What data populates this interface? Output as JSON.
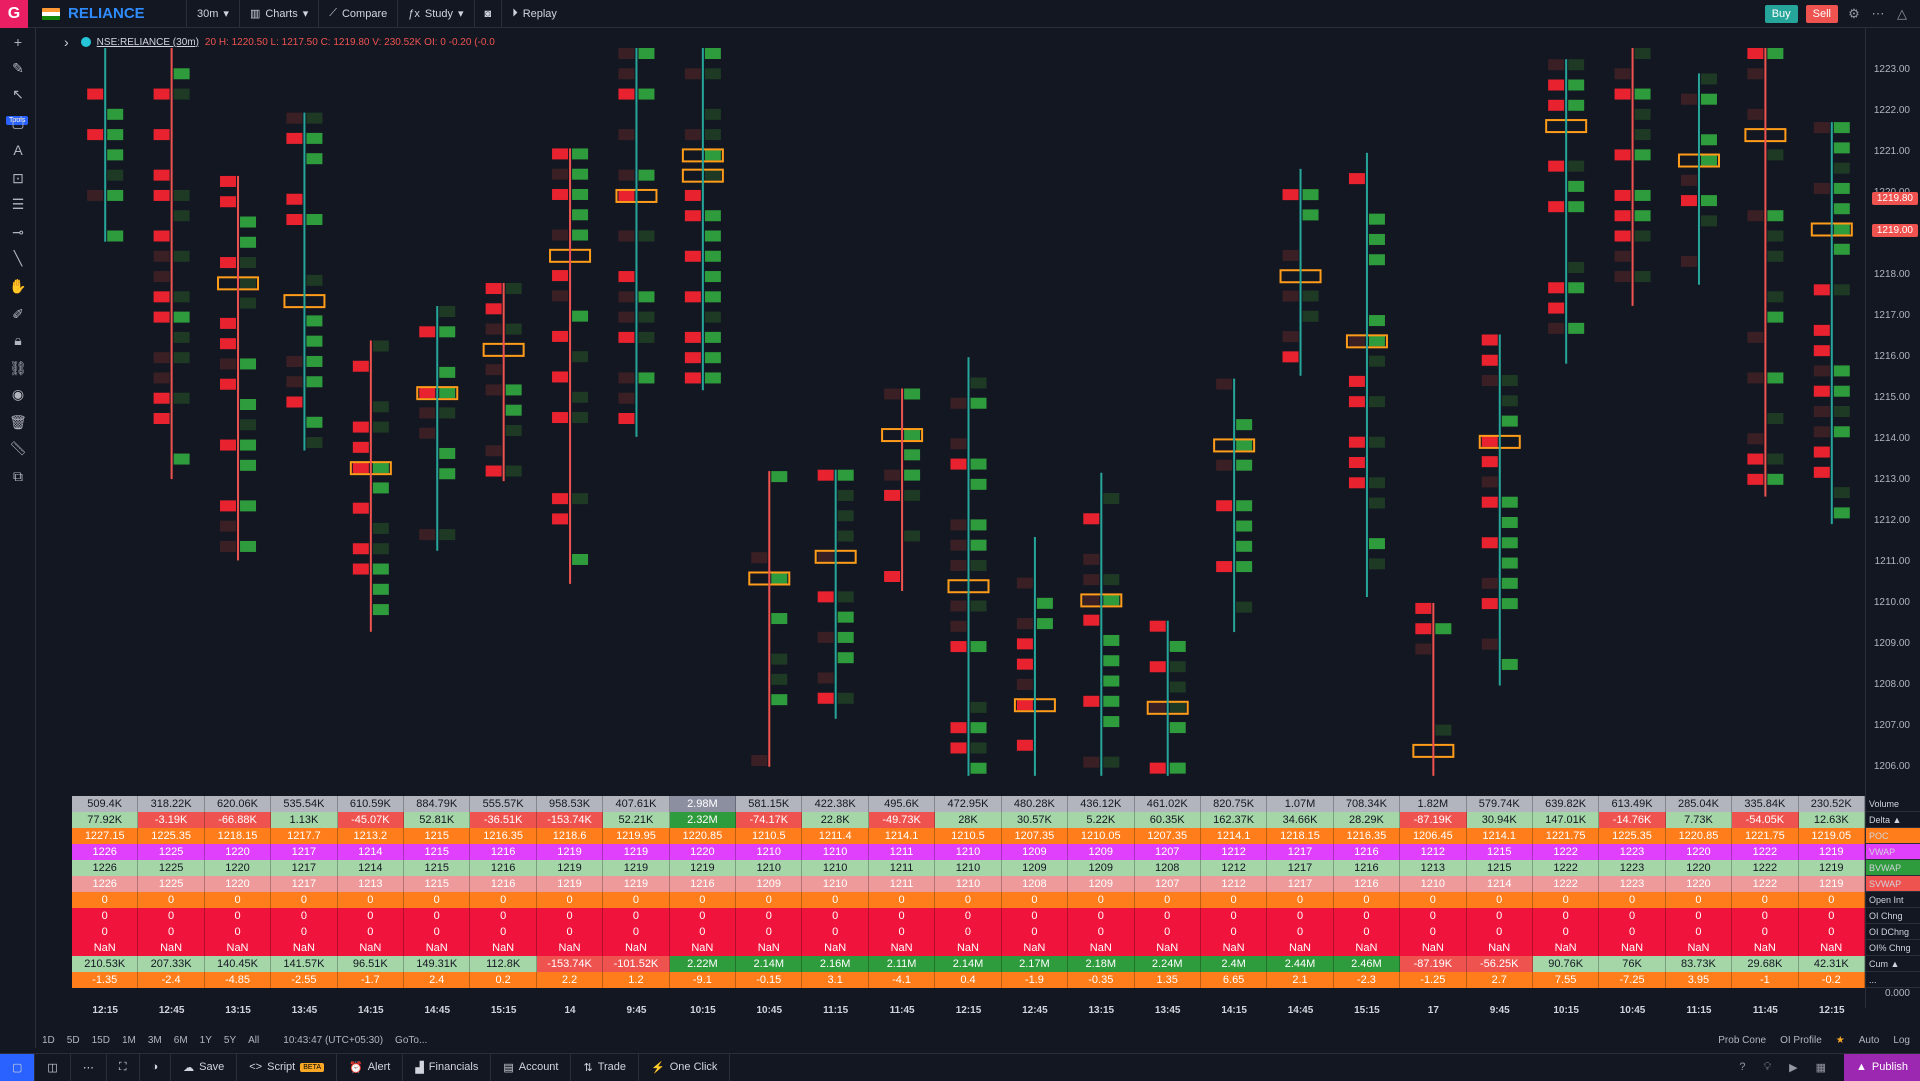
{
  "topbar": {
    "logo": "G",
    "symbol": "RELIANCE",
    "interval": "30m",
    "charts": "Charts",
    "compare": "Compare",
    "study": "Study",
    "replay": "Replay",
    "buy": "Buy",
    "sell": "Sell"
  },
  "tools_label": "Tools",
  "legend": {
    "symbol": "NSE:RELIANCE (30m)",
    "values": "20  H: 1220.50  L: 1217.50  C: 1219.80  V: 230.52K  OI: 0  -0.20  (-0.0"
  },
  "price_axis": {
    "labels": [
      "1223.00",
      "1222.00",
      "1221.00",
      "1220.00",
      "1219.00",
      "1218.00",
      "1217.00",
      "1216.00",
      "1215.00",
      "1214.00",
      "1213.00",
      "1212.00",
      "1211.00",
      "1210.00",
      "1209.00",
      "1208.00",
      "1207.00",
      "1206.00",
      "0.000"
    ],
    "badge1": "1219.80",
    "badge2": "1219.00"
  },
  "table": {
    "row_labels": [
      "Volume",
      "Delta ▲",
      "POC",
      "VWAP",
      "BVWAP",
      "SVWAP",
      "Open Int",
      "OI Chng",
      "OI DChng",
      "OI% Chng",
      "Cum ▲",
      "..."
    ],
    "rows": [
      {
        "bg": "#b2b5be",
        "fg": "#131722",
        "cells": [
          "509.4K",
          "318.22K",
          "620.06K",
          "535.54K",
          "610.59K",
          "884.79K",
          "555.57K",
          "958.53K",
          "407.61K",
          "2.98M",
          "581.15K",
          "422.38K",
          "495.6K",
          "472.95K",
          "480.28K",
          "436.12K",
          "461.02K",
          "820.75K",
          "1.07M",
          "708.34K",
          "1.82M",
          "579.74K",
          "639.82K",
          "613.49K",
          "285.04K",
          "335.84K",
          "230.52K"
        ]
      },
      {
        "bg": "mix",
        "fg": "#131722",
        "cells": [
          "77.92K",
          "-3.19K",
          "-66.88K",
          "1.13K",
          "-45.07K",
          "52.81K",
          "-36.51K",
          "-153.74K",
          "52.21K",
          "2.32M",
          "-74.17K",
          "22.8K",
          "-49.73K",
          "28K",
          "30.57K",
          "5.22K",
          "60.35K",
          "162.37K",
          "34.66K",
          "28.29K",
          "-87.19K",
          "30.94K",
          "147.01K",
          "-14.76K",
          "7.73K",
          "-54.05K",
          "12.63K"
        ]
      },
      {
        "bg": "#ff7d1a",
        "fg": "#ffffff",
        "cells": [
          "1227.15",
          "1225.35",
          "1218.15",
          "1217.7",
          "1213.2",
          "1215",
          "1216.35",
          "1218.6",
          "1219.95",
          "1220.85",
          "1210.5",
          "1211.4",
          "1214.1",
          "1210.5",
          "1207.35",
          "1210.05",
          "1207.35",
          "1214.1",
          "1218.15",
          "1216.35",
          "1206.45",
          "1214.1",
          "1221.75",
          "1225.35",
          "1220.85",
          "1221.75",
          "1219.05"
        ]
      },
      {
        "bg": "#e040fb",
        "fg": "#ffffff",
        "cells": [
          "1226",
          "1225",
          "1220",
          "1217",
          "1214",
          "1215",
          "1216",
          "1219",
          "1219",
          "1220",
          "1210",
          "1210",
          "1211",
          "1210",
          "1209",
          "1209",
          "1207",
          "1212",
          "1217",
          "1216",
          "1212",
          "1215",
          "1222",
          "1223",
          "1220",
          "1222",
          "1219"
        ]
      },
      {
        "bg": "#a5d6a7",
        "fg": "#131722",
        "cells": [
          "1226",
          "1225",
          "1220",
          "1217",
          "1214",
          "1215",
          "1216",
          "1219",
          "1219",
          "1219",
          "1210",
          "1210",
          "1211",
          "1210",
          "1209",
          "1209",
          "1208",
          "1212",
          "1217",
          "1216",
          "1213",
          "1215",
          "1222",
          "1223",
          "1220",
          "1222",
          "1219"
        ]
      },
      {
        "bg": "#ef9a9a",
        "fg": "#ffffff",
        "cells": [
          "1226",
          "1225",
          "1220",
          "1217",
          "1213",
          "1215",
          "1216",
          "1219",
          "1219",
          "1216",
          "1209",
          "1210",
          "1211",
          "1210",
          "1208",
          "1209",
          "1207",
          "1212",
          "1217",
          "1216",
          "1210",
          "1214",
          "1222",
          "1223",
          "1220",
          "1222",
          "1219"
        ]
      },
      {
        "bg": "#ff7d1a",
        "fg": "#ffffff",
        "cells": [
          "0",
          "0",
          "0",
          "0",
          "0",
          "0",
          "0",
          "0",
          "0",
          "0",
          "0",
          "0",
          "0",
          "0",
          "0",
          "0",
          "0",
          "0",
          "0",
          "0",
          "0",
          "0",
          "0",
          "0",
          "0",
          "0",
          "0"
        ]
      },
      {
        "bg": "#f0133c",
        "fg": "#ffffff",
        "cells": [
          "0",
          "0",
          "0",
          "0",
          "0",
          "0",
          "0",
          "0",
          "0",
          "0",
          "0",
          "0",
          "0",
          "0",
          "0",
          "0",
          "0",
          "0",
          "0",
          "0",
          "0",
          "0",
          "0",
          "0",
          "0",
          "0",
          "0"
        ]
      },
      {
        "bg": "#f0133c",
        "fg": "#ffffff",
        "cells": [
          "0",
          "0",
          "0",
          "0",
          "0",
          "0",
          "0",
          "0",
          "0",
          "0",
          "0",
          "0",
          "0",
          "0",
          "0",
          "0",
          "0",
          "0",
          "0",
          "0",
          "0",
          "0",
          "0",
          "0",
          "0",
          "0",
          "0"
        ]
      },
      {
        "bg": "#f0133c",
        "fg": "#ffffff",
        "cells": [
          "NaN",
          "NaN",
          "NaN",
          "NaN",
          "NaN",
          "NaN",
          "NaN",
          "NaN",
          "NaN",
          "NaN",
          "NaN",
          "NaN",
          "NaN",
          "NaN",
          "NaN",
          "NaN",
          "NaN",
          "NaN",
          "NaN",
          "NaN",
          "NaN",
          "NaN",
          "NaN",
          "NaN",
          "NaN",
          "NaN",
          "NaN"
        ]
      },
      {
        "bg": "mix2",
        "fg": "#131722",
        "cells": [
          "210.53K",
          "207.33K",
          "140.45K",
          "141.57K",
          "96.51K",
          "149.31K",
          "112.8K",
          "-153.74K",
          "-101.52K",
          "2.22M",
          "2.14M",
          "2.16M",
          "2.11M",
          "2.14M",
          "2.17M",
          "2.18M",
          "2.24M",
          "2.4M",
          "2.44M",
          "2.46M",
          "-87.19K",
          "-56.25K",
          "90.76K",
          "76K",
          "83.73K",
          "29.68K",
          "42.31K"
        ]
      },
      {
        "bg": "#ff7d1a",
        "fg": "#ffffff",
        "cells": [
          "-1.35",
          "-2.4",
          "-4.85",
          "-2.55",
          "-1.7",
          "2.4",
          "0.2",
          "2.2",
          "1.2",
          "-9.1",
          "-0.15",
          "3.1",
          "-4.1",
          "0.4",
          "-1.9",
          "-0.35",
          "1.35",
          "6.65",
          "2.1",
          "-2.3",
          "-1.25",
          "2.7",
          "7.55",
          "-7.25",
          "3.95",
          "-1",
          "-0.2"
        ]
      }
    ]
  },
  "time_axis": [
    "12:15",
    "12:45",
    "13:15",
    "13:45",
    "14:15",
    "14:45",
    "15:15",
    "14",
    "9:45",
    "10:15",
    "10:45",
    "11:15",
    "11:45",
    "12:15",
    "12:45",
    "13:15",
    "13:45",
    "14:15",
    "14:45",
    "15:15",
    "17",
    "9:45",
    "10:15",
    "10:45",
    "11:15",
    "11:45",
    "12:15"
  ],
  "range_bar": {
    "ranges": [
      "1D",
      "5D",
      "15D",
      "1M",
      "3M",
      "6M",
      "1Y",
      "5Y",
      "All"
    ],
    "clock": "10:43:47 (UTC+05:30)",
    "goto": "GoTo...",
    "right": [
      "Prob Cone",
      "OI Profile",
      "Auto",
      "Log"
    ]
  },
  "bottombar": {
    "save": "Save",
    "script": "Script",
    "beta": "BETA",
    "alert": "Alert",
    "financials": "Financials",
    "account": "Account",
    "trade": "Trade",
    "oneclick": "One Click",
    "publish": "Publish"
  },
  "colors": {
    "red": "#e8232f",
    "green": "#2e9b3c",
    "orange": "#ff9c1a",
    "bg": "#131722"
  }
}
